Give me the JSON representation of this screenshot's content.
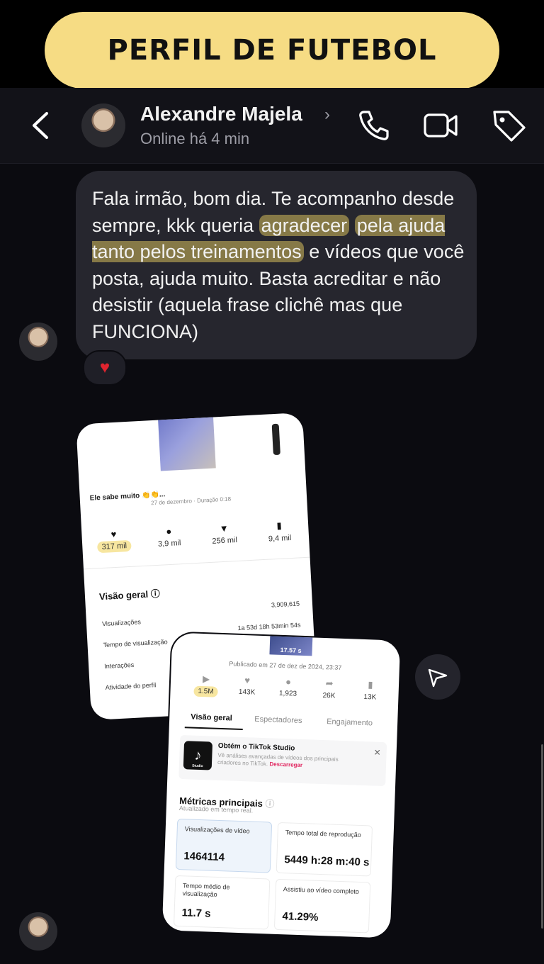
{
  "banner": {
    "title": "PERFIL DE FUTEBOL"
  },
  "header": {
    "name": "Alexandre Majela",
    "status": "Online há 4 min",
    "icons": [
      "back-chevron-icon",
      "phone-icon",
      "video-camera-icon",
      "tag-icon"
    ]
  },
  "message": {
    "part1": "Fala irmão,  bom dia. Te acompanho desde sempre,  kkk queria ",
    "highlight1": "agradecer",
    "highlight2": "pela ajuda tanto pelos treinamentos",
    "part2": " e vídeos que você posta, ajuda muito. Basta acreditar e não desistir (aquela frase clichê mas que FUNCIONA)",
    "reaction": "♥"
  },
  "card1": {
    "caption": "Ele sabe muito 👏👏...",
    "date": "27 de dezembro · Duração 0:18",
    "stats": [
      {
        "icon": "heart-icon",
        "value": "317 mil",
        "highlighted": true
      },
      {
        "icon": "comment-icon",
        "value": "3,9 mil"
      },
      {
        "icon": "share-icon",
        "value": "256 mil"
      },
      {
        "icon": "bookmark-icon",
        "value": "9,4 mil"
      }
    ],
    "overview_title": "Visão geral",
    "rows": [
      {
        "label": "Visualizações",
        "value": "3,909,615"
      },
      {
        "label": "Tempo de visualização",
        "value": "1a 53d 18h 53min 54s"
      },
      {
        "label": "Interações",
        "value": ""
      },
      {
        "label": "Atividade do perfil",
        "value": ""
      }
    ]
  },
  "card2": {
    "duration": "17.57 s",
    "published": "Publicado em 27 de dez de 2024, 23:37",
    "stats": [
      {
        "icon": "play-icon",
        "value": "1.5M",
        "highlighted": true
      },
      {
        "icon": "heart-icon",
        "value": "143K"
      },
      {
        "icon": "comment-icon",
        "value": "1,923"
      },
      {
        "icon": "share-icon",
        "value": "26K"
      },
      {
        "icon": "bookmark-icon",
        "value": "13K"
      }
    ],
    "tabs": [
      "Visão geral",
      "Espectadores",
      "Engajamento"
    ],
    "promo": {
      "title": "Obtém o TikTok Studio",
      "text": "Vê análises avançadas de vídeos dos principais criadores no TikTok.",
      "link": "Descarregar",
      "logo_sub": "Studio"
    },
    "metrics_title": "Métricas principais",
    "metrics_sub": "Atualizado em tempo real.",
    "metrics": [
      {
        "label": "Visualizações de vídeo",
        "value": "1464114"
      },
      {
        "label": "Tempo total de reprodução",
        "value": "5449 h:28 m:40 s"
      },
      {
        "label": "Tempo médio de visualização",
        "value": "11.7 s"
      },
      {
        "label": "Assistiu ao vídeo completo",
        "value": "41.29%"
      }
    ]
  }
}
